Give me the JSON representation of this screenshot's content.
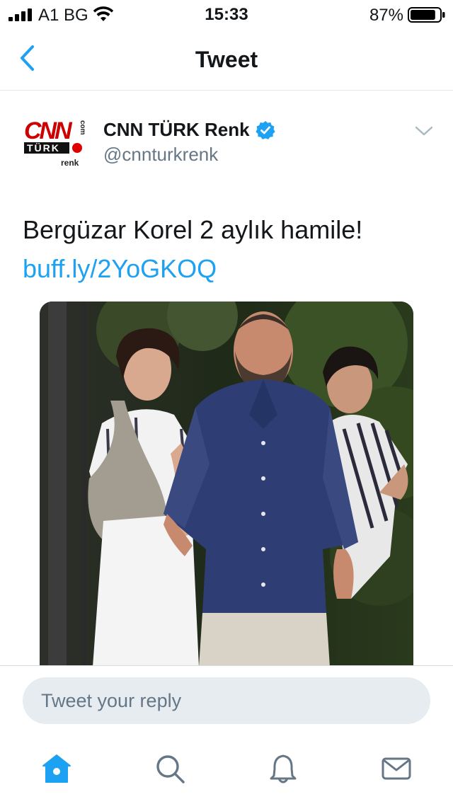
{
  "status_bar": {
    "carrier": "A1 BG",
    "time": "15:33",
    "battery_percent": "87%",
    "battery_level": 0.87,
    "icons": [
      "signal-icon",
      "wifi-icon",
      "battery-icon"
    ]
  },
  "nav": {
    "title": "Tweet",
    "back_icon": "chevron-left-icon"
  },
  "tweet": {
    "author_name": "CNN TÜRK Renk",
    "author_handle": "@cnnturkrenk",
    "verified": true,
    "avatar_logo_text": "CNN TÜRK .com renk",
    "text": "Bergüzar Korel 2 aylık hamile!",
    "link": "buff.ly/2YoGKOQ",
    "media": "photo"
  },
  "reply": {
    "placeholder": "Tweet your reply"
  },
  "tabbar": {
    "items": [
      "home-icon",
      "search-icon",
      "notifications-icon",
      "messages-icon"
    ],
    "active": "home-icon"
  },
  "colors": {
    "accent": "#1da1f2",
    "text": "#14171a",
    "secondary": "#657786",
    "reply_bg": "#e6ecf0",
    "divider": "#e1e8ed"
  }
}
